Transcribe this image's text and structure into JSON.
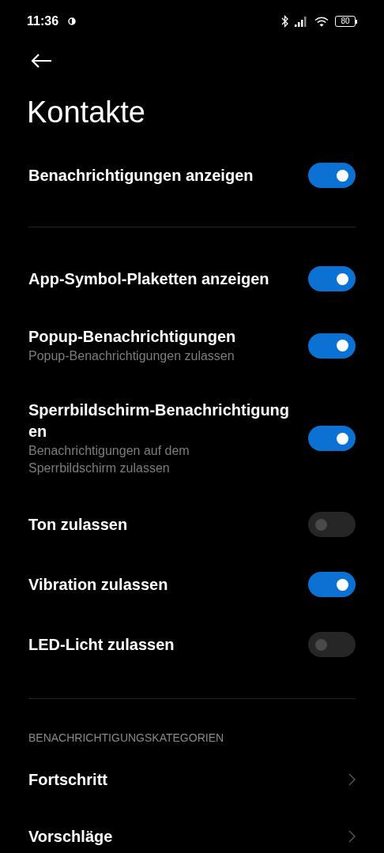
{
  "status_bar": {
    "time": "11:36",
    "battery": "80"
  },
  "title": "Kontakte",
  "main_toggle": {
    "label": "Benachrichtigungen anzeigen",
    "on": true
  },
  "settings": [
    {
      "label": "App-Symbol-Plaketten anzeigen",
      "on": true
    },
    {
      "label": "Popup-Benachrichtigungen",
      "description": "Popup-Benachrichtigungen zulassen",
      "on": true
    },
    {
      "label": "Sperrbildschirm-Benachrichtigungen",
      "description": "Benachrichtigungen auf dem Sperrbildschirm zulassen",
      "on": true
    },
    {
      "label": "Ton zulassen",
      "on": false
    },
    {
      "label": "Vibration zulassen",
      "on": true
    },
    {
      "label": "LED-Licht zulassen",
      "on": false
    }
  ],
  "categories": {
    "header": "BENACHRICHTIGUNGSKATEGORIEN",
    "items": [
      {
        "label": "Fortschritt"
      },
      {
        "label": "Vorschläge"
      }
    ]
  }
}
